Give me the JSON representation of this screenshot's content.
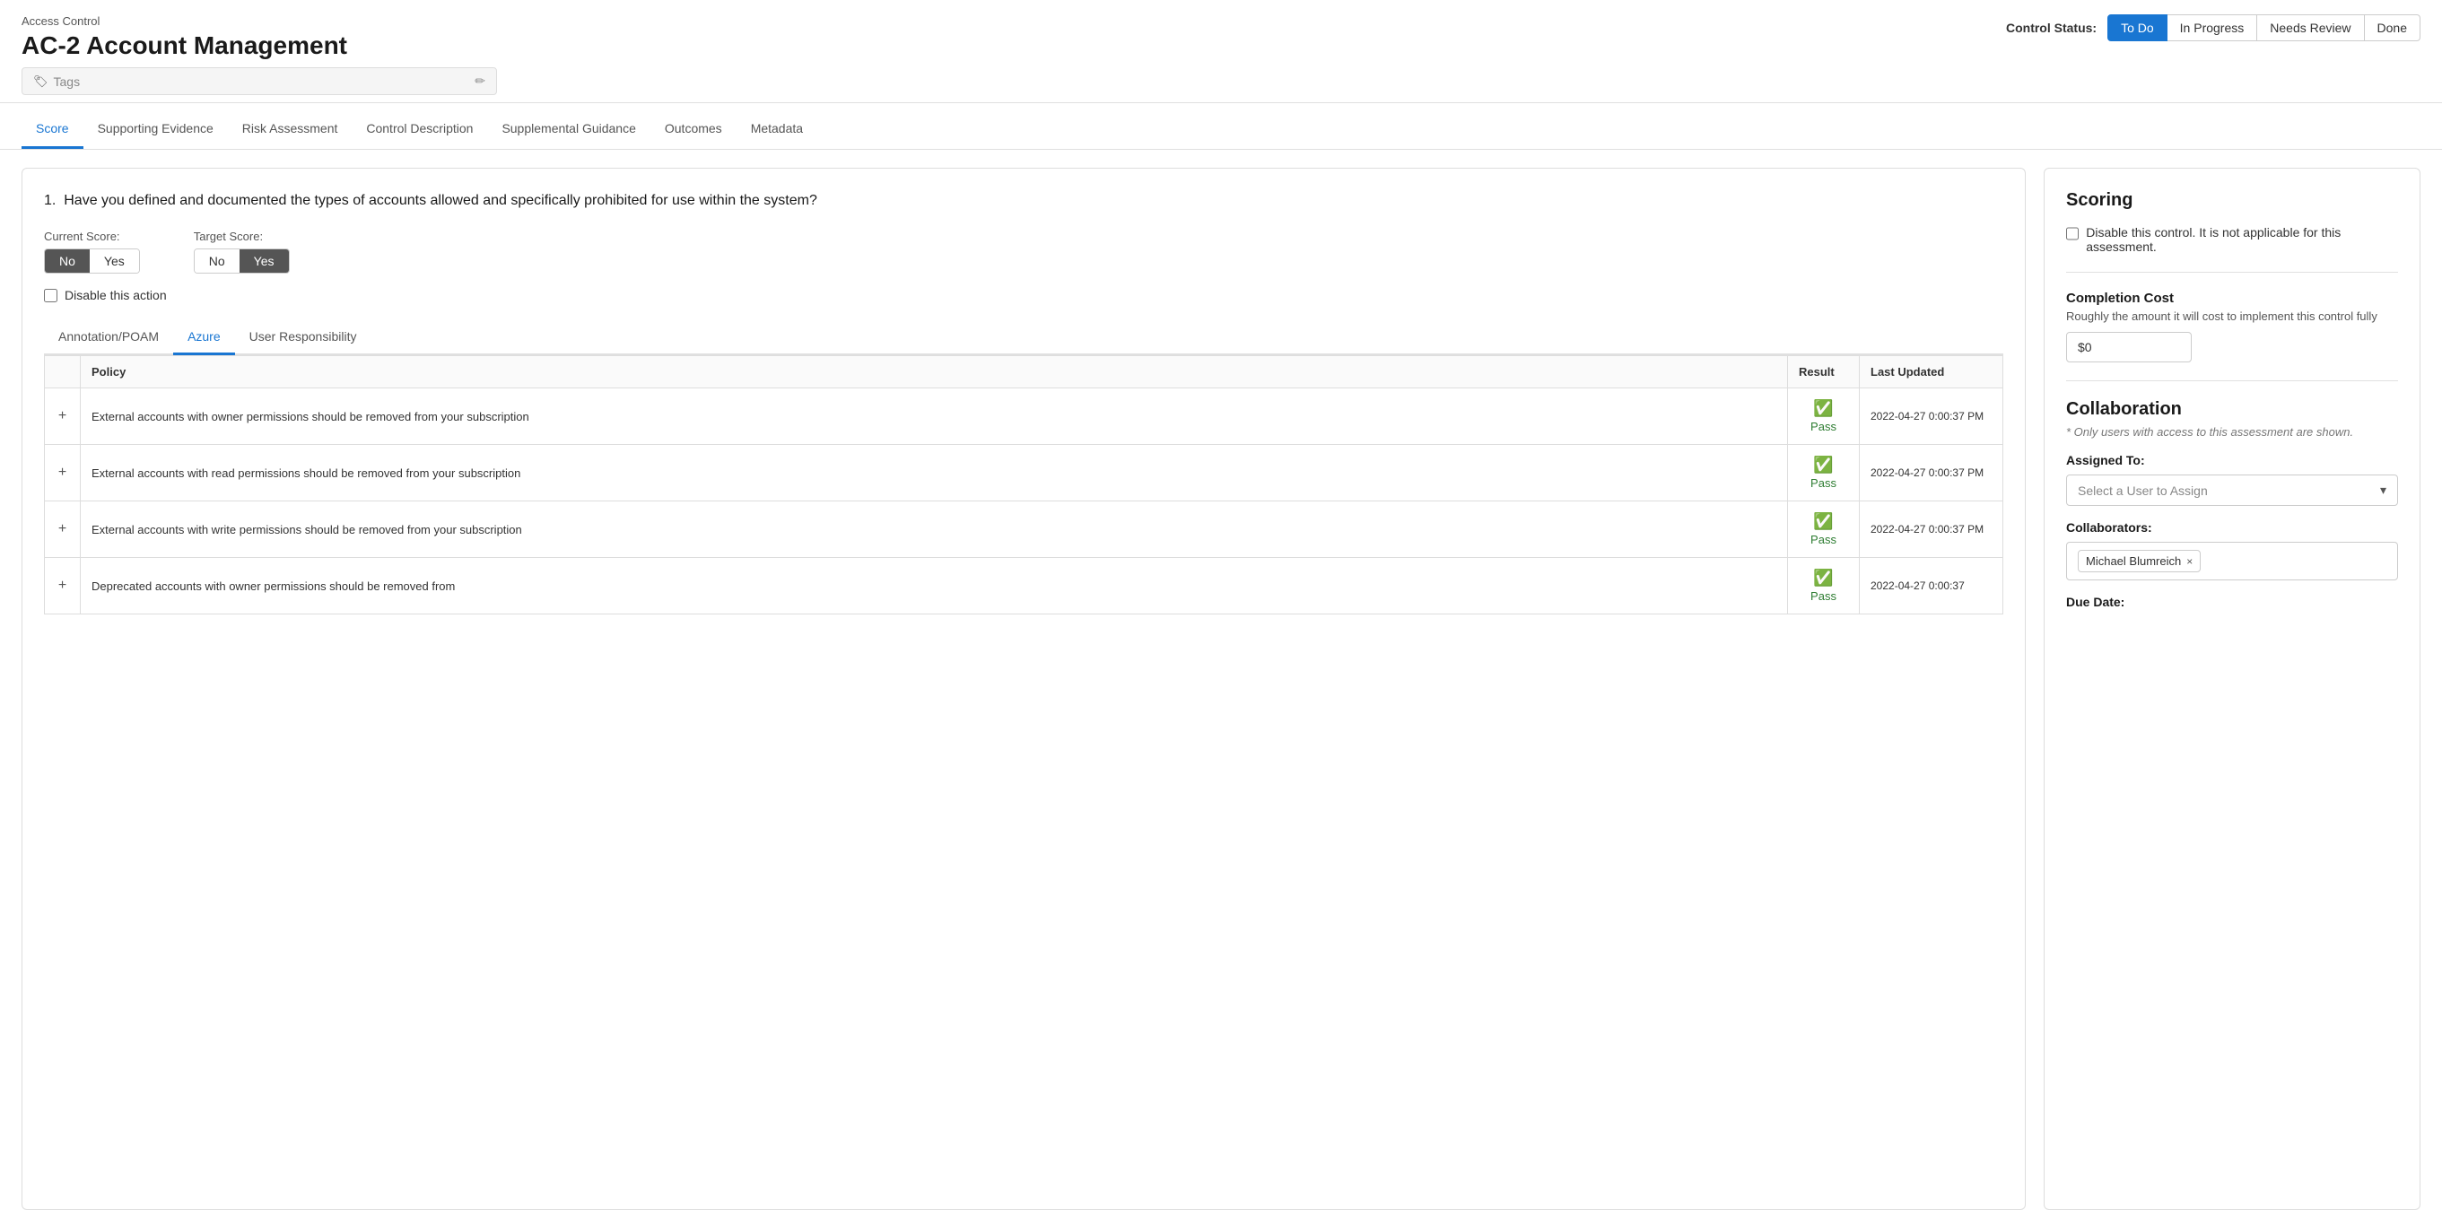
{
  "header": {
    "category": "Access Control",
    "title": "AC-2 Account Management",
    "tags_placeholder": "Tags",
    "tags_edit_icon": "✏"
  },
  "control_status": {
    "label": "Control Status:",
    "options": [
      {
        "label": "To Do",
        "active": true
      },
      {
        "label": "In Progress",
        "active": false
      },
      {
        "label": "Needs Review",
        "active": false
      },
      {
        "label": "Done",
        "active": false
      }
    ]
  },
  "tabs": [
    {
      "label": "Score",
      "active": true
    },
    {
      "label": "Supporting Evidence",
      "active": false
    },
    {
      "label": "Risk Assessment",
      "active": false
    },
    {
      "label": "Control Description",
      "active": false
    },
    {
      "label": "Supplemental Guidance",
      "active": false
    },
    {
      "label": "Outcomes",
      "active": false
    },
    {
      "label": "Metadata",
      "active": false
    }
  ],
  "question": {
    "number": "1.",
    "text": "Have you defined and documented the types of accounts allowed and specifically prohibited for use within the system?",
    "current_score_label": "Current Score:",
    "current_score_no": "No",
    "current_score_yes": "Yes",
    "current_selected": "no",
    "target_score_label": "Target Score:",
    "target_score_no": "No",
    "target_score_yes": "Yes",
    "target_selected": "yes",
    "disable_action_label": "Disable this action"
  },
  "sub_tabs": [
    {
      "label": "Annotation/POAM",
      "active": false
    },
    {
      "label": "Azure",
      "active": true
    },
    {
      "label": "User Responsibility",
      "active": false
    }
  ],
  "policy_table": {
    "headers": [
      "",
      "Policy",
      "Result",
      "Last Updated"
    ],
    "rows": [
      {
        "expand": "+",
        "policy": "External accounts with owner permissions should be removed from your subscription",
        "result": "Pass",
        "updated": "2022-04-27 0:00:37 PM"
      },
      {
        "expand": "+",
        "policy": "External accounts with read permissions should be removed from your subscription",
        "result": "Pass",
        "updated": "2022-04-27 0:00:37 PM"
      },
      {
        "expand": "+",
        "policy": "External accounts with write permissions should be removed from your subscription",
        "result": "Pass",
        "updated": "2022-04-27 0:00:37 PM"
      },
      {
        "expand": "+",
        "policy": "Deprecated accounts with owner permissions should be removed from",
        "result": "Pass",
        "updated": "2022-04-27 0:00:37"
      }
    ]
  },
  "scoring": {
    "title": "Scoring",
    "disable_control_label": "Disable this control. It is not applicable for this assessment.",
    "completion_cost_title": "Completion Cost",
    "completion_cost_desc": "Roughly the amount it will cost to implement this control fully",
    "cost_value": "$0"
  },
  "collaboration": {
    "title": "Collaboration",
    "note": "* Only users with access to this assessment are shown.",
    "assigned_to_label": "Assigned To:",
    "assign_placeholder": "Select a User to Assign",
    "collaborators_label": "Collaborators:",
    "collaborators": [
      {
        "name": "Michael Blumreich"
      }
    ],
    "due_date_label": "Due Date:"
  }
}
